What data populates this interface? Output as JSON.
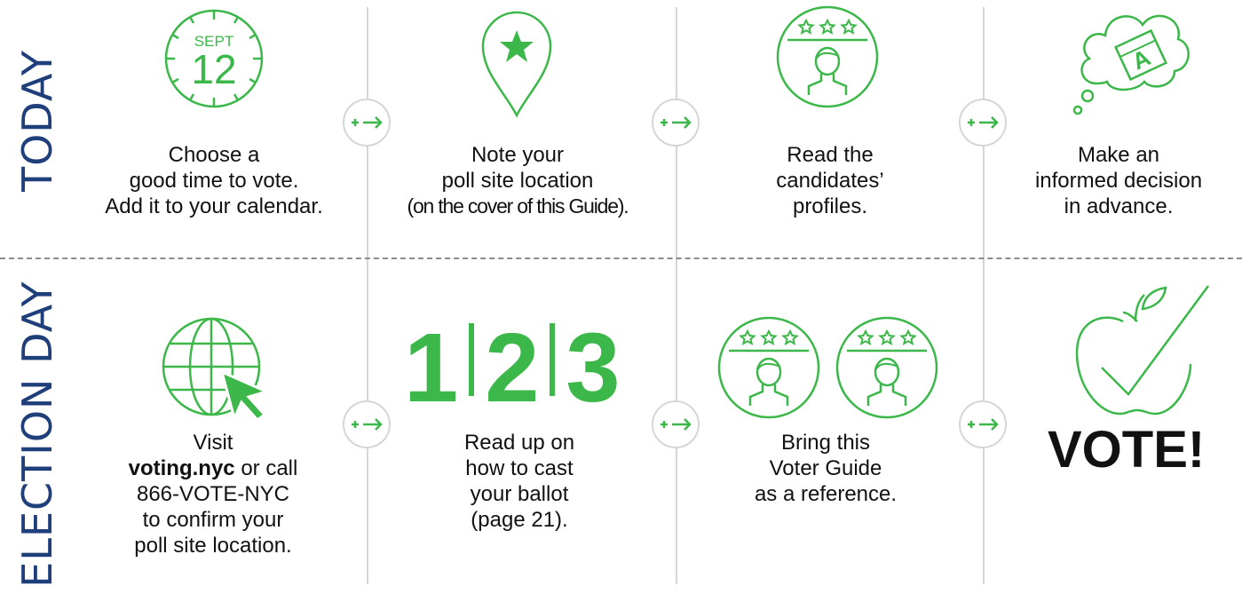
{
  "rows": {
    "today_label": "TODAY",
    "election_label": "ELECTION DAY"
  },
  "today": {
    "calendar": {
      "month": "SEPT",
      "day": "12"
    },
    "step1": [
      "Choose a",
      "good time to vote.",
      "Add it to your calendar."
    ],
    "step2": [
      "Note your",
      "poll site location",
      "(on the cover of this Guide)."
    ],
    "step3": [
      "Read the",
      "candidates’",
      "profiles."
    ],
    "step4": [
      "Make an",
      "informed decision",
      "in advance."
    ],
    "thought_letter": "A"
  },
  "election": {
    "step1": {
      "line1": "Visit",
      "link": "voting.nyc",
      "after_link": " or call",
      "lines": [
        "866-VOTE-NYC",
        "to confirm your",
        "poll site location."
      ]
    },
    "numbers": [
      "1",
      "2",
      "3"
    ],
    "step2": [
      "Read up on",
      "how to cast",
      "your ballot",
      "(page 21)."
    ],
    "step3": [
      "Bring this",
      "Voter Guide",
      "as a reference."
    ],
    "vote": "VOTE!"
  },
  "colors": {
    "green": "#3cb749",
    "navy": "#1f3f7a",
    "divider": "#d6d6d6",
    "dash": "#8c8c8c"
  },
  "icons": [
    "clock-calendar-icon",
    "map-pin-star-icon",
    "candidate-profile-icon",
    "thought-bubble-ballot-icon",
    "globe-cursor-icon",
    "apple-check-icon",
    "plus-arrow-icon"
  ]
}
